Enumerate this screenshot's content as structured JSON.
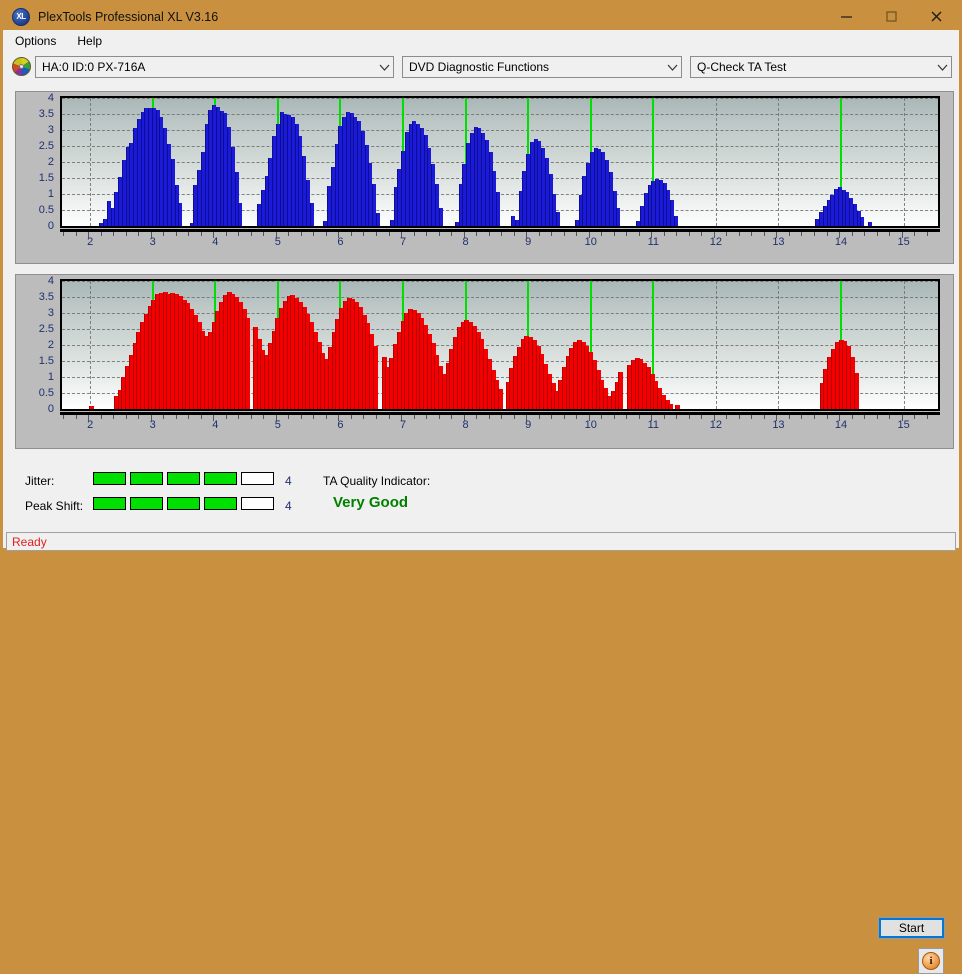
{
  "window": {
    "title": "PlexTools Professional XL V3.16",
    "icon": "disc-xl-icon",
    "controls": {
      "minimize": "–",
      "maximize": "□",
      "close": "✕"
    }
  },
  "menu": {
    "items": [
      "Options",
      "Help"
    ]
  },
  "toolbar": {
    "drive_icon": "optical-disc-icon",
    "drive_select": {
      "value": "HA:0 ID:0  PX-716A"
    },
    "function_select": {
      "value": "DVD Diagnostic Functions"
    },
    "test_select": {
      "value": "Q-Check TA Test"
    }
  },
  "results": {
    "jitter_label": "Jitter:",
    "jitter_value": "4",
    "jitter_filled": 4,
    "jitter_total": 5,
    "peak_shift_label": "Peak Shift:",
    "peak_shift_value": "4",
    "peak_shift_filled": 4,
    "peak_shift_total": 5,
    "ta_title": "TA Quality Indicator:",
    "ta_value": "Very Good",
    "ta_color": "#008000",
    "start_label": "Start",
    "info_label": "i"
  },
  "status": {
    "text": "Ready",
    "color": "#e02020"
  },
  "chart_data": [
    {
      "type": "bar",
      "name": "ta-chart-top",
      "title": "",
      "xlabel": "",
      "ylabel": "",
      "color": "#1a1ad8",
      "marker_color": "#00e000",
      "xlim": [
        1.55,
        15.55
      ],
      "ylim": [
        0,
        4
      ],
      "yticks": [
        0,
        0.5,
        1,
        1.5,
        2,
        2.5,
        3,
        3.5,
        4
      ],
      "ytick_labels": [
        "0",
        "0.5",
        "1",
        "1.5",
        "2",
        "2.5",
        "3",
        "3.5",
        "4"
      ],
      "xticks": [
        2,
        3,
        4,
        5,
        6,
        7,
        8,
        9,
        10,
        11,
        12,
        13,
        14,
        15
      ],
      "xtick_labels": [
        "2",
        "3",
        "4",
        "5",
        "6",
        "7",
        "8",
        "9",
        "10",
        "11",
        "12",
        "13",
        "14",
        "15"
      ],
      "grid": true,
      "markers": [
        3,
        4,
        5,
        6,
        7,
        8,
        9,
        10,
        11,
        14
      ],
      "x": [
        2.18,
        2.24,
        2.3,
        2.36,
        2.42,
        2.48,
        2.54,
        2.6,
        2.66,
        2.72,
        2.78,
        2.84,
        2.9,
        2.96,
        3.02,
        3.08,
        3.14,
        3.2,
        3.26,
        3.32,
        3.38,
        3.44,
        3.62,
        3.68,
        3.74,
        3.8,
        3.86,
        3.92,
        3.98,
        4.04,
        4.1,
        4.16,
        4.22,
        4.28,
        4.34,
        4.4,
        4.7,
        4.76,
        4.82,
        4.88,
        4.94,
        5.0,
        5.06,
        5.12,
        5.18,
        5.24,
        5.3,
        5.36,
        5.42,
        5.48,
        5.54,
        5.76,
        5.82,
        5.88,
        5.94,
        6.0,
        6.06,
        6.12,
        6.18,
        6.24,
        6.3,
        6.36,
        6.42,
        6.48,
        6.54,
        6.6,
        6.82,
        6.88,
        6.94,
        7.0,
        7.06,
        7.12,
        7.18,
        7.24,
        7.3,
        7.36,
        7.42,
        7.48,
        7.54,
        7.6,
        7.86,
        7.92,
        7.98,
        8.04,
        8.1,
        8.16,
        8.22,
        8.28,
        8.34,
        8.4,
        8.46,
        8.52,
        8.76,
        8.82,
        8.88,
        8.94,
        9.0,
        9.06,
        9.12,
        9.18,
        9.24,
        9.3,
        9.36,
        9.42,
        9.48,
        9.78,
        9.84,
        9.9,
        9.96,
        10.02,
        10.08,
        10.14,
        10.2,
        10.26,
        10.32,
        10.38,
        10.44,
        10.76,
        10.82,
        10.88,
        10.94,
        11.0,
        11.06,
        11.12,
        11.18,
        11.24,
        11.3,
        11.36,
        13.62,
        13.68,
        13.74,
        13.8,
        13.86,
        13.92,
        13.98,
        14.04,
        14.1,
        14.16,
        14.22,
        14.28,
        14.34,
        14.46
      ],
      "values": [
        0.1,
        0.22,
        0.78,
        0.55,
        1.05,
        1.52,
        2.05,
        2.48,
        2.6,
        3.05,
        3.35,
        3.55,
        3.7,
        3.68,
        3.7,
        3.62,
        3.42,
        3.05,
        2.55,
        2.1,
        1.28,
        0.72,
        0.1,
        1.28,
        1.75,
        2.3,
        3.18,
        3.62,
        3.78,
        3.72,
        3.6,
        3.52,
        3.1,
        2.48,
        1.7,
        0.72,
        0.7,
        1.12,
        1.55,
        2.12,
        2.8,
        3.2,
        3.55,
        3.5,
        3.48,
        3.4,
        3.2,
        2.8,
        2.2,
        1.45,
        0.72,
        0.15,
        1.25,
        1.85,
        2.55,
        3.12,
        3.42,
        3.55,
        3.52,
        3.42,
        3.28,
        2.98,
        2.52,
        1.98,
        1.3,
        0.4,
        0.18,
        1.22,
        1.78,
        2.35,
        2.95,
        3.2,
        3.28,
        3.2,
        3.05,
        2.85,
        2.45,
        1.95,
        1.3,
        0.55,
        0.12,
        1.3,
        1.95,
        2.6,
        2.9,
        3.08,
        3.05,
        2.92,
        2.7,
        2.3,
        1.72,
        1.05,
        0.3,
        0.18,
        1.1,
        1.72,
        2.25,
        2.62,
        2.72,
        2.65,
        2.45,
        2.12,
        1.62,
        1.0,
        0.45,
        0.2,
        0.98,
        1.55,
        1.98,
        2.3,
        2.45,
        2.42,
        2.3,
        2.05,
        1.68,
        1.1,
        0.55,
        0.15,
        0.62,
        1.02,
        1.28,
        1.42,
        1.48,
        1.45,
        1.35,
        1.12,
        0.8,
        0.3,
        0.22,
        0.45,
        0.62,
        0.82,
        0.98,
        1.15,
        1.22,
        1.12,
        1.05,
        0.88,
        0.68,
        0.48,
        0.28,
        0.12
      ]
    },
    {
      "type": "bar",
      "name": "ta-chart-bottom",
      "title": "",
      "xlabel": "",
      "ylabel": "",
      "color": "#f40000",
      "marker_color": "#00e000",
      "xlim": [
        1.55,
        15.55
      ],
      "ylim": [
        0,
        4
      ],
      "yticks": [
        0,
        0.5,
        1,
        1.5,
        2,
        2.5,
        3,
        3.5,
        4
      ],
      "ytick_labels": [
        "0",
        "0.5",
        "1",
        "1.5",
        "2",
        "2.5",
        "3",
        "3.5",
        "4"
      ],
      "xticks": [
        2,
        3,
        4,
        5,
        6,
        7,
        8,
        9,
        10,
        11,
        12,
        13,
        14,
        15
      ],
      "xtick_labels": [
        "2",
        "3",
        "4",
        "5",
        "6",
        "7",
        "8",
        "9",
        "10",
        "11",
        "12",
        "13",
        "14",
        "15"
      ],
      "grid": true,
      "markers": [
        3,
        4,
        5,
        6,
        7,
        8,
        9,
        10,
        11,
        14
      ],
      "x": [
        2.02,
        2.42,
        2.48,
        2.54,
        2.6,
        2.66,
        2.72,
        2.78,
        2.84,
        2.9,
        2.96,
        3.02,
        3.08,
        3.14,
        3.2,
        3.26,
        3.32,
        3.38,
        3.44,
        3.5,
        3.56,
        3.62,
        3.68,
        3.74,
        3.8,
        3.86,
        3.92,
        3.98,
        4.04,
        4.1,
        4.16,
        4.22,
        4.28,
        4.34,
        4.4,
        4.46,
        4.52,
        4.64,
        4.7,
        4.76,
        4.82,
        4.88,
        4.94,
        5.0,
        5.06,
        5.12,
        5.18,
        5.24,
        5.3,
        5.36,
        5.42,
        5.48,
        5.54,
        5.6,
        5.66,
        5.72,
        5.78,
        5.84,
        5.9,
        5.96,
        6.02,
        6.08,
        6.14,
        6.2,
        6.26,
        6.32,
        6.38,
        6.44,
        6.5,
        6.56,
        6.7,
        6.76,
        6.82,
        6.88,
        6.94,
        7.0,
        7.06,
        7.12,
        7.18,
        7.24,
        7.3,
        7.36,
        7.42,
        7.48,
        7.54,
        7.6,
        7.66,
        7.72,
        7.78,
        7.84,
        7.9,
        7.96,
        8.02,
        8.08,
        8.14,
        8.2,
        8.26,
        8.32,
        8.38,
        8.44,
        8.5,
        8.56,
        8.68,
        8.74,
        8.8,
        8.86,
        8.92,
        8.98,
        9.04,
        9.1,
        9.16,
        9.22,
        9.28,
        9.34,
        9.4,
        9.46,
        9.52,
        9.58,
        9.64,
        9.7,
        9.76,
        9.82,
        9.88,
        9.94,
        10.0,
        10.06,
        10.12,
        10.18,
        10.24,
        10.3,
        10.36,
        10.42,
        10.48,
        10.62,
        10.68,
        10.74,
        10.8,
        10.86,
        10.92,
        10.98,
        11.04,
        11.1,
        11.16,
        11.22,
        11.28,
        11.38,
        13.7,
        13.76,
        13.82,
        13.88,
        13.94,
        14.0,
        14.06,
        14.12,
        14.18,
        14.24
      ],
      "values": [
        0.1,
        0.42,
        0.58,
        1.0,
        1.35,
        1.7,
        2.05,
        2.4,
        2.72,
        2.98,
        3.22,
        3.42,
        3.58,
        3.62,
        3.65,
        3.6,
        3.62,
        3.58,
        3.52,
        3.42,
        3.3,
        3.12,
        2.95,
        2.72,
        2.45,
        2.28,
        2.4,
        2.72,
        3.05,
        3.35,
        3.55,
        3.65,
        3.6,
        3.5,
        3.35,
        3.12,
        2.85,
        2.55,
        2.2,
        1.85,
        1.7,
        2.05,
        2.45,
        2.85,
        3.15,
        3.38,
        3.52,
        3.55,
        3.48,
        3.35,
        3.18,
        2.98,
        2.72,
        2.42,
        2.1,
        1.75,
        1.55,
        1.95,
        2.42,
        2.82,
        3.15,
        3.38,
        3.48,
        3.45,
        3.35,
        3.18,
        2.95,
        2.68,
        2.35,
        1.98,
        1.62,
        1.3,
        1.58,
        2.02,
        2.42,
        2.75,
        3.0,
        3.12,
        3.1,
        3.0,
        2.85,
        2.62,
        2.35,
        2.05,
        1.7,
        1.35,
        1.08,
        1.45,
        1.88,
        2.25,
        2.55,
        2.72,
        2.78,
        2.72,
        2.6,
        2.42,
        2.18,
        1.88,
        1.55,
        1.22,
        0.9,
        0.62,
        0.85,
        1.28,
        1.65,
        1.95,
        2.18,
        2.28,
        2.25,
        2.15,
        1.98,
        1.72,
        1.42,
        1.1,
        0.8,
        0.55,
        0.9,
        1.3,
        1.65,
        1.92,
        2.08,
        2.15,
        2.1,
        1.98,
        1.78,
        1.52,
        1.22,
        0.92,
        0.65,
        0.42,
        0.55,
        0.85,
        1.15,
        1.38,
        1.52,
        1.58,
        1.55,
        1.45,
        1.3,
        1.1,
        0.88,
        0.65,
        0.45,
        0.28,
        0.15,
        0.12,
        0.82,
        1.25,
        1.62,
        1.88,
        2.08,
        2.15,
        2.12,
        1.98,
        1.62,
        1.12
      ]
    }
  ]
}
